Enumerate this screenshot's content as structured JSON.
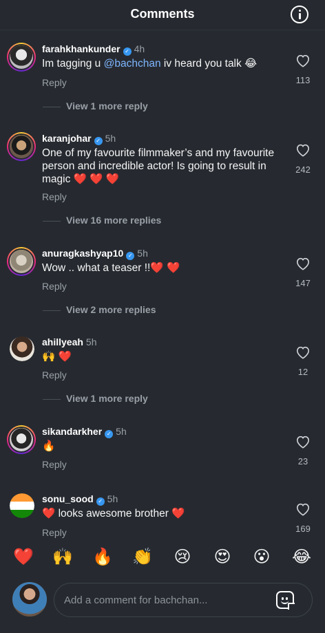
{
  "header": {
    "title": "Comments"
  },
  "comments": [
    {
      "username": "farahkhankunder",
      "time": "4h",
      "text_before": "Im tagging u ",
      "mention": "@bachchan",
      "text_after": " iv heard you talk 😂",
      "reply_label": "Reply",
      "likes": "113",
      "view_more": "View 1 more reply"
    },
    {
      "username": "karanjohar",
      "time": "5h",
      "text": "One of my favourite filmmaker’s and my favourite person and incredible actor! Is going to result in magic ❤️ ❤️ ❤️",
      "reply_label": "Reply",
      "likes": "242",
      "view_more": "View 16 more replies"
    },
    {
      "username": "anuragkashyap10",
      "time": "5h",
      "text": "Wow .. what a teaser !!❤️ ❤️",
      "reply_label": "Reply",
      "likes": "147",
      "view_more": "View 2 more replies"
    },
    {
      "username": "ahillyeah",
      "time": "5h",
      "text": "🙌 ❤️",
      "reply_label": "Reply",
      "likes": "12",
      "view_more": "View 1 more reply"
    },
    {
      "username": "sikandarkher",
      "time": "5h",
      "text": "🔥",
      "reply_label": "Reply",
      "likes": "23"
    },
    {
      "username": "sonu_sood",
      "time": "5h",
      "text": "❤️ looks awesome brother ❤️",
      "reply_label": "Reply",
      "likes": "169"
    }
  ],
  "quick_reactions": [
    "❤️",
    "🙌",
    "🔥",
    "👏",
    "😢",
    "😍",
    "😮",
    "😂"
  ],
  "composer": {
    "placeholder": "Add a comment for bachchan..."
  },
  "icons": {
    "info": "info-icon",
    "like": "heart-outline-icon",
    "verified": "verified-badge-icon",
    "sticker": "sticker-icon"
  },
  "colors": {
    "background": "#262a30",
    "mention": "#7fb6ff",
    "verified": "#3797f0"
  }
}
